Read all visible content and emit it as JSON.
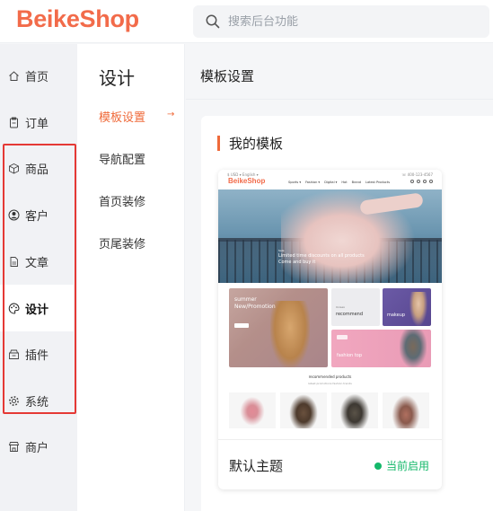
{
  "brand": {
    "logo_text": "BeikeShop",
    "accent_color": "#ef6a3a",
    "logo_color": "#f26b4a"
  },
  "search": {
    "placeholder": "搜索后台功能",
    "value": ""
  },
  "sidebar": {
    "items": [
      {
        "label": "首页",
        "icon": "home-icon"
      },
      {
        "label": "订单",
        "icon": "clipboard-icon"
      },
      {
        "label": "商品",
        "icon": "box-icon"
      },
      {
        "label": "客户",
        "icon": "user-circle-icon"
      },
      {
        "label": "文章",
        "icon": "document-icon"
      },
      {
        "label": "设计",
        "icon": "palette-icon",
        "active": true
      },
      {
        "label": "插件",
        "icon": "plugin-icon"
      },
      {
        "label": "系统",
        "icon": "gear-icon"
      },
      {
        "label": "商户",
        "icon": "store-icon"
      }
    ],
    "highlight_box_color": "#e53935"
  },
  "submenu": {
    "title": "设计",
    "items": [
      {
        "label": "模板设置",
        "active": true
      },
      {
        "label": "导航配置"
      },
      {
        "label": "首页装修"
      },
      {
        "label": "页尾装修"
      }
    ],
    "active_arrow": "→"
  },
  "main": {
    "page_title": "模板设置",
    "card_title": "我的模板",
    "template": {
      "name": "默认主题",
      "status": "当前启用",
      "status_color": "#14b86a",
      "preview": {
        "top_left": "$ USD ▾  English ▾",
        "top_right": "☏ 400-123-4567",
        "logo": "BeikeShop",
        "nav": [
          "Sports ▾",
          "Fashion ▾",
          "Digital ▾",
          "Hot",
          "Brand",
          "Latest Products"
        ],
        "hero_small": "Sale",
        "hero_line1": "Limited time discounts on all products",
        "hero_line2": "Come and buy it",
        "tile1_line1": "summer",
        "tile1_line2": "New/Promotion",
        "tile1_small": "Shop now",
        "tile2_small": "Unisex",
        "tile2_text": "recommend",
        "tile3_text": "makeup",
        "tile4_text": "fashion top",
        "rec_title": "recommended products",
        "rec_tabs": "latest promotions     fashion trends"
      }
    }
  }
}
